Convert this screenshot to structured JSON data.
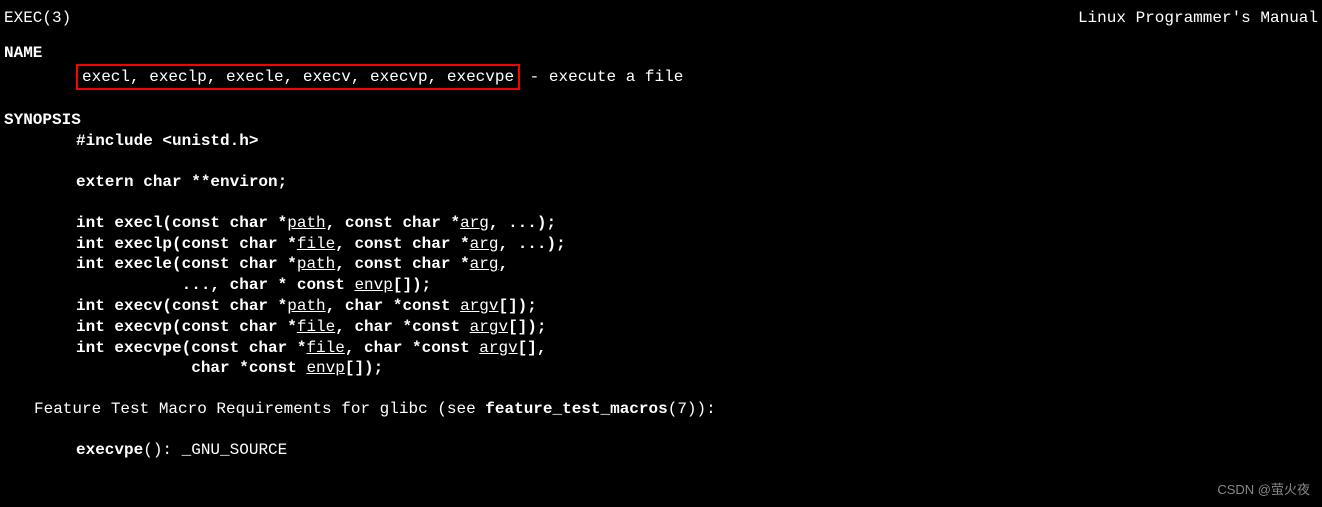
{
  "header": {
    "left": "EXEC(3)",
    "right": "Linux Programmer's Manual"
  },
  "sections": {
    "name": {
      "heading": "NAME",
      "functions": "execl, execlp, execle, execv, execvp, execvpe",
      "separator": " - ",
      "description": "execute a file"
    },
    "synopsis": {
      "heading": "SYNOPSIS",
      "include_prefix": "#include ",
      "include_file": "<unistd.h>",
      "extern": "extern char **environ;",
      "sig1": {
        "pre": "int execl(const char *",
        "p1": "path",
        "mid": ", const char *",
        "p2": "arg",
        "post": ", ...);"
      },
      "sig2": {
        "pre": "int execlp(const char *",
        "p1": "file",
        "mid": ", const char *",
        "p2": "arg",
        "post": ", ...);"
      },
      "sig3": {
        "pre": "int execle(const char *",
        "p1": "path",
        "mid": ", const char *",
        "p2": "arg",
        "post": ","
      },
      "sig3b": {
        "indent": "           ",
        "pre": "..., char * const ",
        "p1": "envp",
        "post": "[]);"
      },
      "sig4": {
        "pre": "int execv(const char *",
        "p1": "path",
        "mid": ", char *const ",
        "p2": "argv",
        "post": "[]);"
      },
      "sig5": {
        "pre": "int execvp(const char *",
        "p1": "file",
        "mid": ", char *const ",
        "p2": "argv",
        "post": "[]);"
      },
      "sig6": {
        "pre": "int execvpe(const char *",
        "p1": "file",
        "mid": ", char *const ",
        "p2": "argv",
        "post": "[],"
      },
      "sig6b": {
        "indent": "            ",
        "pre": "char *const ",
        "p1": "envp",
        "post": "[]);"
      }
    },
    "feature": {
      "text_pre": "Feature Test Macro Requirements for glibc (see ",
      "text_bold": "feature_test_macros",
      "text_post": "(7)):",
      "detail_bold": "execvpe",
      "detail_rest": "(): _GNU_SOURCE"
    }
  },
  "watermark": "CSDN @萤火夜"
}
